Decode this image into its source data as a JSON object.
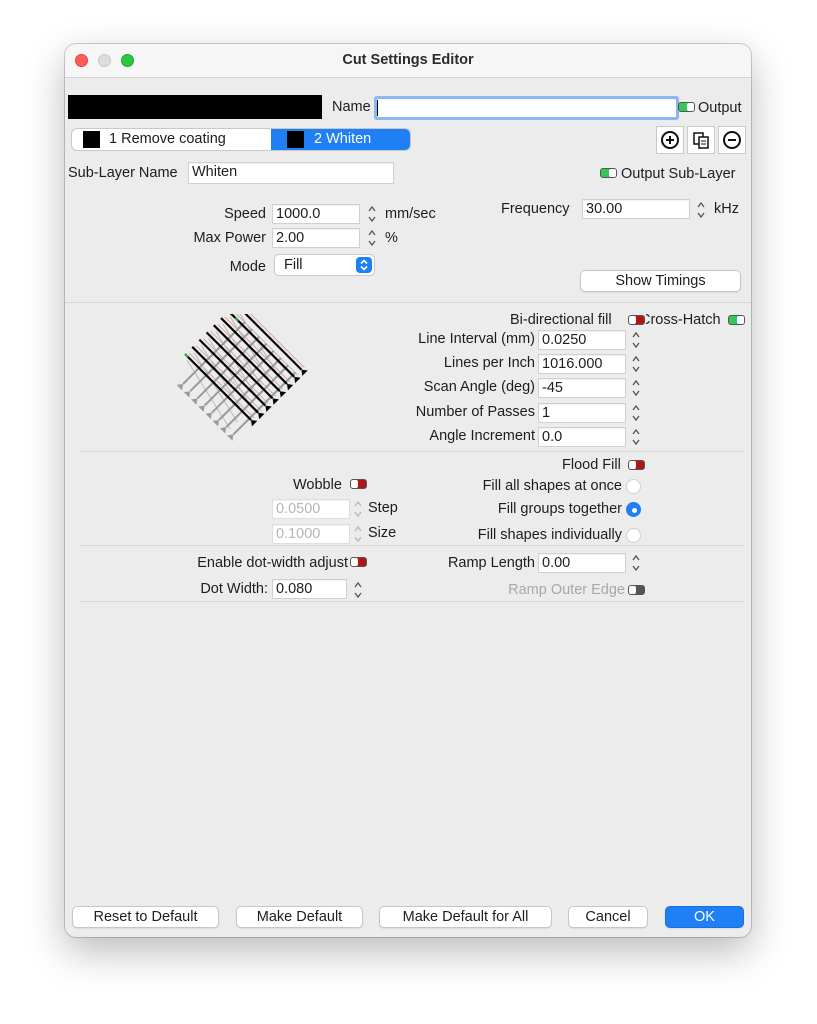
{
  "window": {
    "title": "Cut Settings Editor"
  },
  "top": {
    "name_label": "Name",
    "name_value": "",
    "output_label": "Output"
  },
  "layers": [
    {
      "label": "1 Remove coating",
      "color": "#000000"
    },
    {
      "label": "2 Whiten",
      "color": "#000000"
    }
  ],
  "sublayer": {
    "name_label": "Sub-Layer Name",
    "name_value": "Whiten",
    "output_label": "Output Sub-Layer"
  },
  "params": {
    "speed_label": "Speed",
    "speed_value": "1000.0",
    "speed_unit": "mm/sec",
    "max_power_label": "Max Power",
    "max_power_value": "2.00",
    "max_power_unit": "%",
    "mode_label": "Mode",
    "mode_value": "Fill",
    "frequency_label": "Frequency",
    "frequency_value": "30.00",
    "frequency_unit": "kHz",
    "show_timings": "Show Timings"
  },
  "fill": {
    "bidirectional_label": "Bi-directional fill",
    "crosshatch_label": "Cross-Hatch",
    "line_interval_label": "Line Interval (mm)",
    "line_interval_value": "0.0250",
    "lpi_label": "Lines per Inch",
    "lpi_value": "1016.000",
    "scan_angle_label": "Scan Angle (deg)",
    "scan_angle_value": "-45",
    "passes_label": "Number of Passes",
    "passes_value": "1",
    "angle_inc_label": "Angle Increment",
    "angle_inc_value": "0.0"
  },
  "flood": {
    "flood_label": "Flood Fill",
    "wobble_label": "Wobble",
    "step_value": "0.0500",
    "step_label": "Step",
    "size_value": "0.1000",
    "size_label": "Size",
    "opt_all": "Fill all shapes at once",
    "opt_groups": "Fill groups together",
    "opt_individual": "Fill shapes individually",
    "selected": "Fill groups together"
  },
  "dot": {
    "enable_label": "Enable dot-width adjust",
    "dot_width_label": "Dot Width:",
    "dot_width_value": "0.080",
    "ramp_length_label": "Ramp Length",
    "ramp_length_value": "0.00",
    "ramp_outer_label": "Ramp Outer Edge"
  },
  "footer": {
    "reset": "Reset to Default",
    "make_default": "Make Default",
    "make_default_all": "Make Default for All",
    "cancel": "Cancel",
    "ok": "OK"
  },
  "colors": {
    "accent": "#1f7ff5",
    "toggle_on": "#34c759",
    "toggle_off": "#b01616"
  },
  "icons": [
    "close-window",
    "minimize-window",
    "zoom-window",
    "add-icon",
    "copy-icon",
    "remove-icon",
    "stepper",
    "chevron-updown"
  ]
}
